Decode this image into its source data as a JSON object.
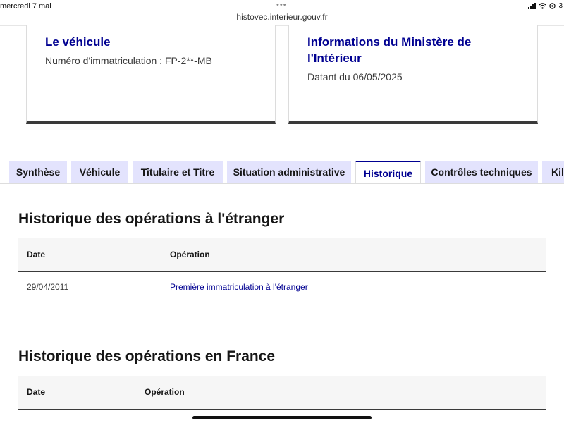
{
  "status_bar": {
    "time": "mercredi 7 mai",
    "url": "histovec.interieur.gouv.fr",
    "more_dots": "•••",
    "battery": "3"
  },
  "cards": {
    "vehicle": {
      "title": "Le véhicule",
      "subtitle": "Numéro d'immatriculation : FP-2**-MB"
    },
    "ministry": {
      "title": "Informations du Ministère de l'Intérieur",
      "subtitle": "Datant du 06/05/2025"
    }
  },
  "tabs": [
    {
      "label": "Synthèse",
      "active": false
    },
    {
      "label": "Véhicule",
      "active": false
    },
    {
      "label": "Titulaire et Titre",
      "active": false
    },
    {
      "label": "Situation administrative",
      "active": false
    },
    {
      "label": "Historique",
      "active": true
    },
    {
      "label": "Contrôles techniques",
      "active": false
    },
    {
      "label": "Kil",
      "active": false
    }
  ],
  "foreign_history": {
    "title": "Historique des opérations à l'étranger",
    "columns": [
      "Date",
      "Opération"
    ],
    "rows": [
      {
        "date": "29/04/2011",
        "operation": "Première immatriculation à l'étranger"
      }
    ]
  },
  "france_history": {
    "title": "Historique des opérations en France",
    "columns": [
      "Date",
      "Opération"
    ]
  },
  "colors": {
    "accent": "#000091",
    "tab_bg": "#e3e3fd",
    "header_bg": "#f6f6f6"
  }
}
